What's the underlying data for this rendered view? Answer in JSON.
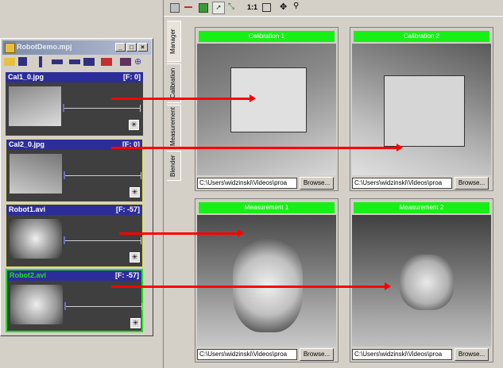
{
  "left_window": {
    "title": "RobotDemo.mpj",
    "controls": [
      "_",
      "□",
      "×"
    ],
    "tracks": [
      {
        "name": "Cal1_0.jpg",
        "frame": "[F: 0]"
      },
      {
        "name": "Cal2_0.jpg",
        "frame": "[F: 0]"
      },
      {
        "name": "Robot1.avi",
        "frame": "[F: -57]"
      },
      {
        "name": "Robot2.avi",
        "frame": "[F: -57]"
      }
    ]
  },
  "top_toolbar": {
    "zoom_label": "1:1"
  },
  "side_tabs": [
    "Manager",
    "Calibration",
    "Measurement",
    "Blender"
  ],
  "panels": [
    {
      "caption": "Calibration 1",
      "path": "C:\\Users\\widzinski\\Videos\\proa",
      "button": "Browse..."
    },
    {
      "caption": "Calibration 2",
      "path": "C:\\Users\\widzinski\\Videos\\proa",
      "button": "Browse..."
    },
    {
      "caption": "Measurement 1",
      "path": "C:\\Users\\widzinski\\Videos\\proa",
      "button": "Browse..."
    },
    {
      "caption": "Measurement 2",
      "path": "C:\\Users\\widzinski\\Videos\\proa",
      "button": "Browse..."
    }
  ],
  "colors": {
    "caption_green": "#17f017",
    "arrow_red": "#ff0000",
    "track_header_blue": "#2d2d9a"
  }
}
